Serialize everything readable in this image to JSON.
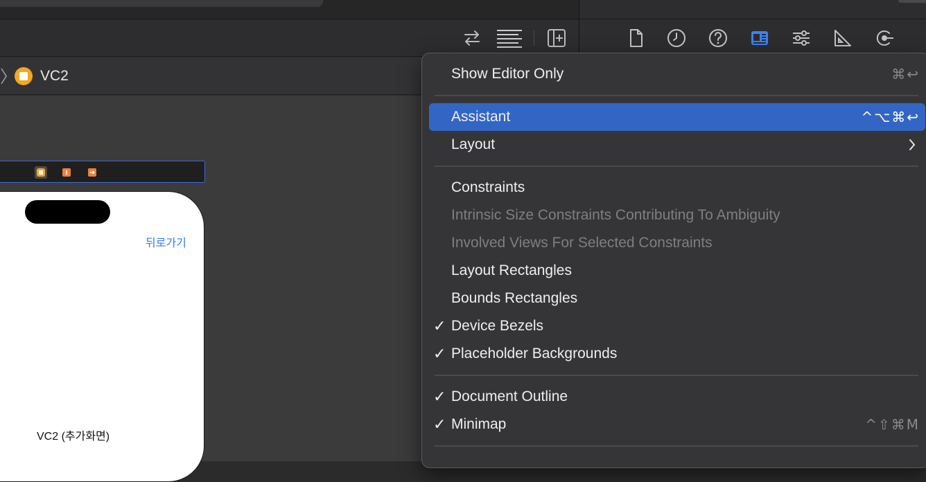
{
  "breadcrumb": {
    "label": "VC2"
  },
  "canvas": {
    "back_link": "뒤로가기",
    "vc_label": "VC2 (추가화면)"
  },
  "menu": {
    "items": [
      {
        "label": "Show Editor Only",
        "shortcut": "⌘↩",
        "checked": false,
        "disabled": false
      },
      {
        "label": "Assistant",
        "shortcut": "^⌥⌘↩",
        "checked": false,
        "disabled": false,
        "highlighted": true
      },
      {
        "label": "Layout",
        "submenu": true,
        "checked": false,
        "disabled": false
      },
      {
        "label": "Constraints",
        "checked": false,
        "disabled": false
      },
      {
        "label": "Intrinsic Size Constraints Contributing To Ambiguity",
        "checked": false,
        "disabled": true
      },
      {
        "label": "Involved Views For Selected Constraints",
        "checked": false,
        "disabled": true
      },
      {
        "label": "Layout Rectangles",
        "checked": false,
        "disabled": false
      },
      {
        "label": "Bounds Rectangles",
        "checked": false,
        "disabled": false
      },
      {
        "label": "Device Bezels",
        "checked": true,
        "disabled": false
      },
      {
        "label": "Placeholder Backgrounds",
        "checked": true,
        "disabled": false
      },
      {
        "label": "Document Outline",
        "checked": true,
        "disabled": false
      },
      {
        "label": "Minimap",
        "shortcut": "^⇧⌘M",
        "checked": true,
        "disabled": false
      }
    ],
    "check_glyph": "✓"
  },
  "icons": {
    "toolbar": [
      "swap-arrows-icon",
      "align-lines-icon",
      "add-editor-icon"
    ],
    "inspector": [
      "file-icon",
      "history-clock-icon",
      "help-icon",
      "identity-card-icon",
      "attributes-sliders-icon",
      "size-ruler-icon",
      "connections-icon"
    ]
  },
  "colors": {
    "accent": "#3366c4",
    "inspector_active": "#3b82f6",
    "vc_icon": "#f5a623",
    "link": "#2f7cf6"
  }
}
